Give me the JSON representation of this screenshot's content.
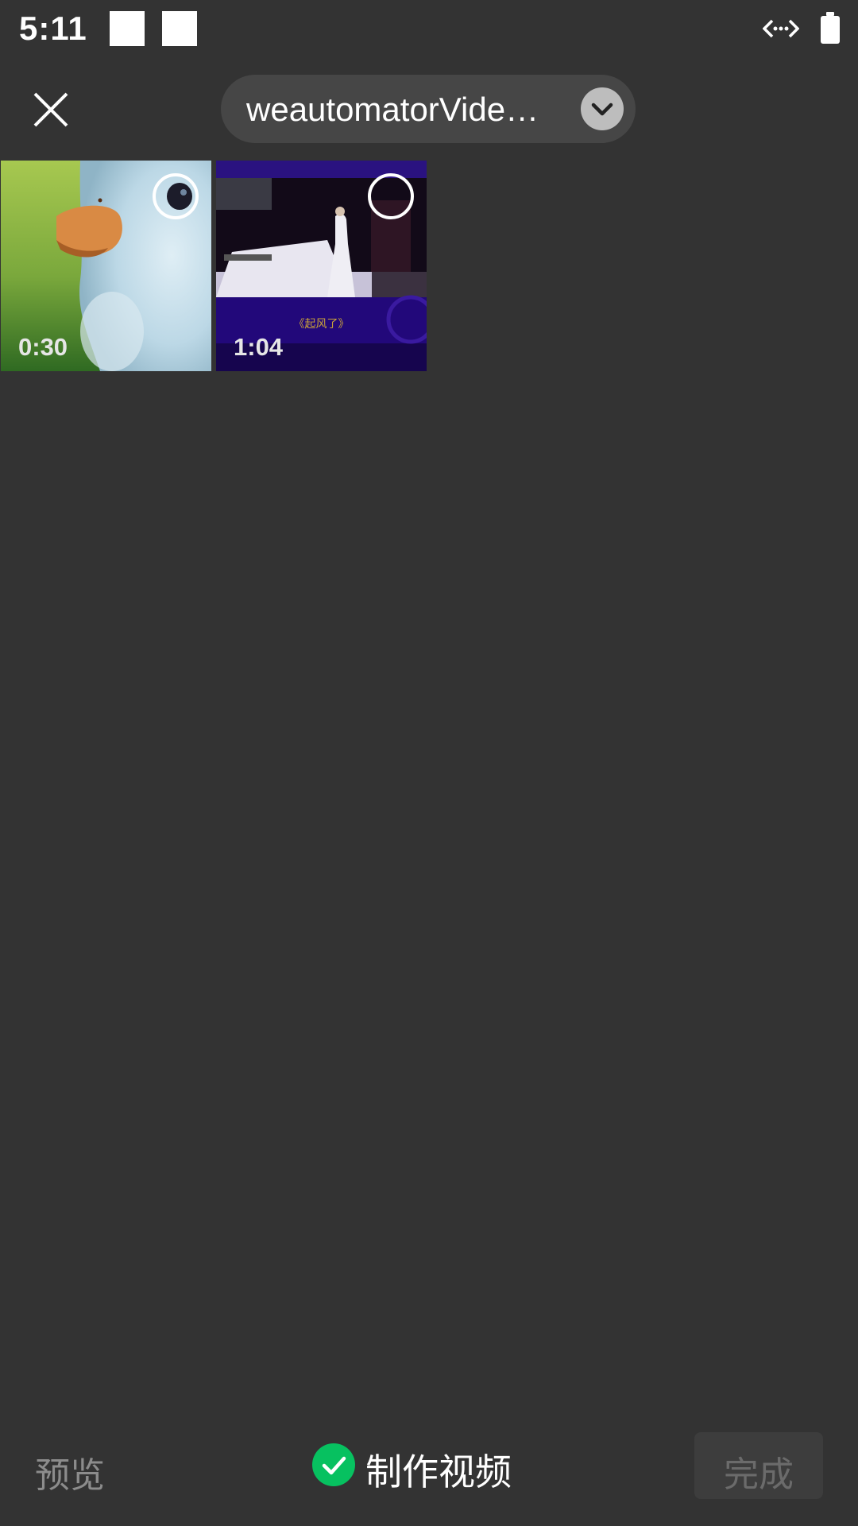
{
  "status_bar": {
    "time": "5:11"
  },
  "header": {
    "album_title": "weautomatorVide…",
    "close_icon": "close-icon",
    "dropdown_icon": "chevron-down-icon"
  },
  "grid": {
    "items": [
      {
        "duration": "0:30",
        "thumbnail": "cartoon duck close-up"
      },
      {
        "duration": "1:04",
        "thumbnail": "stage performance purple",
        "caption": "《起风了》"
      }
    ]
  },
  "bottom_bar": {
    "preview_label": "预览",
    "make_video_label": "制作视频",
    "done_label": "完成"
  },
  "colors": {
    "background": "#333333",
    "accent": "#07c160"
  }
}
